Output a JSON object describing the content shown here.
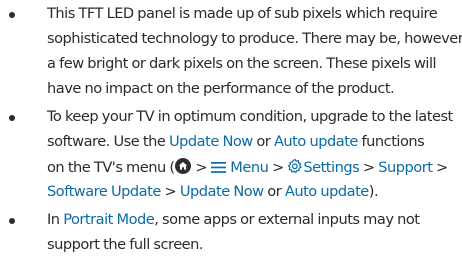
{
  "bullets": [
    {
      "lines": [
        "This TFT LED panel is made up of sub pixels which require",
        "sophisticated technology to produce. There may be, however,",
        "a few bright or dark pixels on the screen. These pixels will",
        "have no impact on the performance of the product."
      ]
    },
    {
      "line1": "To keep your TV in optimum condition, upgrade to the latest",
      "line2": {
        "pre": "software. Use the ",
        "update_now": "Update Now",
        "or": " or ",
        "auto_update": "Auto update",
        "post": " functions"
      },
      "line3": {
        "pre": "on the TV's menu (",
        "sep1": " > ",
        "menu": "Menu",
        "sep2": " > ",
        "settings": "Settings",
        "sep3": " > ",
        "support": "Support",
        "sep4": " >"
      },
      "line4": {
        "software_update": "Software Update",
        "sep": " > ",
        "update_now": "Update Now",
        "or": " or ",
        "auto_update": "Auto update",
        "post": ")."
      }
    },
    {
      "line1": {
        "pre": "In ",
        "portrait_mode": "Portrait Mode",
        "post": ", some apps or external inputs may not"
      },
      "line2": "support the full screen."
    }
  ],
  "icons": {
    "home": "home-icon",
    "menu": "hamburger-menu-icon",
    "settings": "gear-icon"
  },
  "colors": {
    "text": "#2b2b2b",
    "highlight": "#0b6ba5"
  }
}
